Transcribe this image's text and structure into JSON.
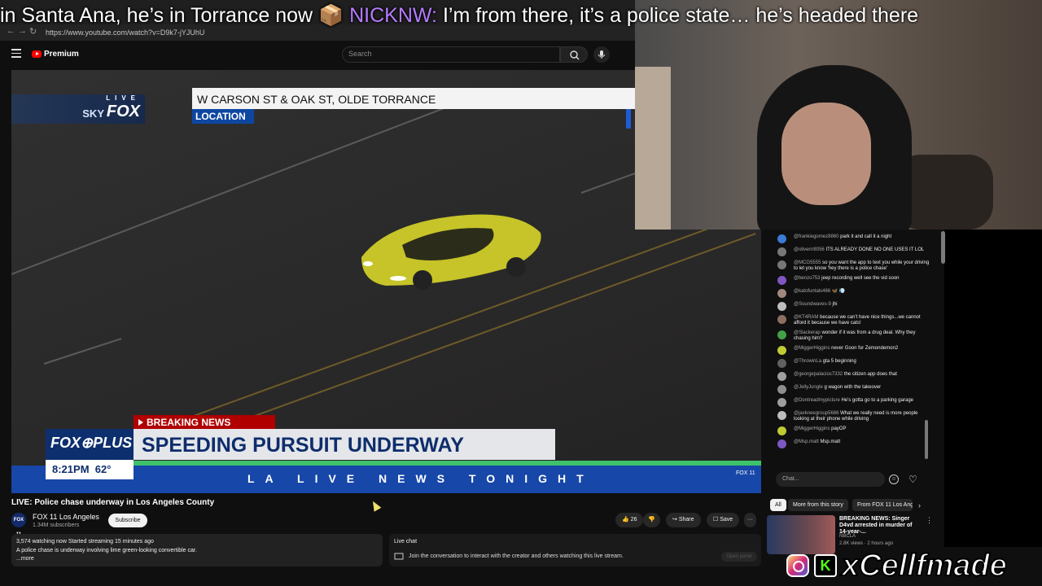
{
  "overlay": {
    "message_start": "in Santa Ana, he’s in Torrance now",
    "emote": "📦",
    "author": "NICKNW:",
    "message": "I’m from there, it’s a police state… he’s headed there"
  },
  "browser": {
    "url": "https://www.youtube.com/watch?v=D9k7-jYJUhU"
  },
  "youtube": {
    "brand": "Premium",
    "search_placeholder": "Search"
  },
  "video": {
    "skyfox_live": "LIVE",
    "skyfox_sky": "SKY",
    "skyfox_fox": "FOX",
    "location_text": "W CARSON ST & OAK ST, OLDE TORRANCE",
    "location_tag": "LOCATION",
    "breaking": "BREAKING NEWS",
    "brand": "FOX⊕PLUS",
    "headline": "SPEEDING PURSUIT UNDERWAY",
    "time": "8:21PM",
    "temp": "62°",
    "ticker": "LA LIVE NEWS TONIGHT",
    "badge": "FOX 11"
  },
  "meta": {
    "title": "LIVE: Police chase underway in Los Angeles County",
    "channel_avatar": "FOX 11",
    "channel": "FOX 11 Los Angeles",
    "subs": "1.34M subscribers",
    "subscribe": "Subscribe",
    "likes": "26",
    "share": "Share",
    "save": "Save",
    "more": "···",
    "watching": "3,574 watching now  Started streaming 15 minutes ago",
    "desc": "A police chase is underway involving lime green-looking convertible car.",
    "desc_more": "...more",
    "livechat_title": "Live chat",
    "livechat_desc": "Join the conversation to interact with the creator and others watching this live stream.",
    "open_panel": "Open panel"
  },
  "chat": {
    "messages": [
      {
        "author": "@frankiegomez8860",
        "text": "park it and call it a night",
        "color": "#3a7bd5"
      },
      {
        "author": "@oliverrr8056",
        "text": "ITS ALREADY DONE NO ONE USES IT LOL",
        "color": "#777777"
      },
      {
        "author": "@MCG5555",
        "text": "so you want the app to text you while your driving to let you know 'hey there is a police chase'",
        "color": "#777777"
      },
      {
        "author": "@benzo753",
        "text": "jeep recording well see the vid soon",
        "color": "#7e57c2"
      },
      {
        "author": "@katofuntals466",
        "text": "🦋 💨",
        "color": "#a1887f"
      },
      {
        "author": "@Soundwaves-9",
        "text": "jhi",
        "color": "#bdbdbd"
      },
      {
        "author": "@KT4RAM",
        "text": "because we can't have nice things...we cannot afford it because we have cats!",
        "color": "#8d6e63"
      },
      {
        "author": "@Slackerap",
        "text": "wonder if it was from a drug deal. Why they chasing him?",
        "color": "#43a047"
      },
      {
        "author": "@MiggerHiggins",
        "text": "never Goon for Zemondemon2",
        "color": "#c0ca33"
      },
      {
        "author": "@ThrowinLa",
        "text": "gta 5 beginning",
        "color": "#616161"
      },
      {
        "author": "@georgepalacios7332",
        "text": "the citizen app does that",
        "color": "#9e9e9e"
      },
      {
        "author": "@JellyJungle",
        "text": "g wagon with the takeover",
        "color": "#8e8e8e"
      },
      {
        "author": "@Dontreadmypicture",
        "text": "He's gotta go to a parking garage",
        "color": "#9e9e9e"
      },
      {
        "author": "@jaxkneegroup5686",
        "text": "What we really need is more people looking at their phone while driving",
        "color": "#bdbdbd"
      },
      {
        "author": "@MiggerHiggins",
        "text": "payOP",
        "color": "#c0ca33"
      },
      {
        "author": "@Msp.matt",
        "text": "Msp.matt",
        "color": "#7e57c2"
      }
    ],
    "input_placeholder": "Chat...",
    "emoji": "☺",
    "heart": "♡"
  },
  "chips": {
    "all": "All",
    "more_story": "More from this story",
    "from_fox": "From FOX 11 Los Angeles"
  },
  "recommendation": {
    "title": "BREAKING NEWS: Singer D4vd arrested in murder of 14-year-...",
    "channel": "NBCLA",
    "views": "2.8K views · 2 hours ago"
  },
  "social": {
    "handle": "Cellfmade",
    "x": "x"
  },
  "icons": [
    "menu-icon",
    "youtube-logo-icon",
    "search-icon",
    "mic-icon",
    "like-icon",
    "dislike-icon",
    "share-icon",
    "save-icon",
    "chat-icon",
    "emoji-icon",
    "heart-icon",
    "instagram-icon",
    "kick-icon"
  ]
}
